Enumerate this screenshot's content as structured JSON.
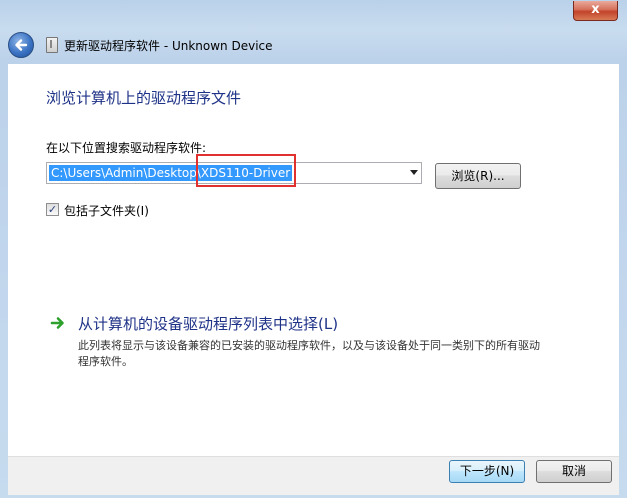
{
  "window": {
    "title": "更新驱动程序软件 - Unknown Device",
    "close_label": "x"
  },
  "main": {
    "heading": "浏览计算机上的驱动程序文件",
    "search_label": "在以下位置搜索驱动程序软件:",
    "path_value": "C:\\Users\\Admin\\Desktop\\XDS110-Driver",
    "browse_label": "浏览(R)...",
    "include_subfolders": {
      "label": "包括子文件夹(I)",
      "checked": true,
      "check_glyph": "✓"
    },
    "pick_option": {
      "title": "从计算机的设备驱动程序列表中选择(L)",
      "description": "此列表将显示与该设备兼容的已安装的驱动程序软件，以及与该设备处于同一类别下的所有驱动程序软件。"
    }
  },
  "footer": {
    "next_label": "下一步(N)",
    "cancel_label": "取消"
  },
  "colors": {
    "heading": "#1e3287",
    "selection": "#3399ff",
    "highlight_box": "#e0312f",
    "arrow": "#2ea02e"
  },
  "icons": {
    "back": "back-arrow-icon",
    "device": "device-icon",
    "option_arrow": "green-arrow-icon",
    "dropdown": "chevron-down-icon"
  }
}
